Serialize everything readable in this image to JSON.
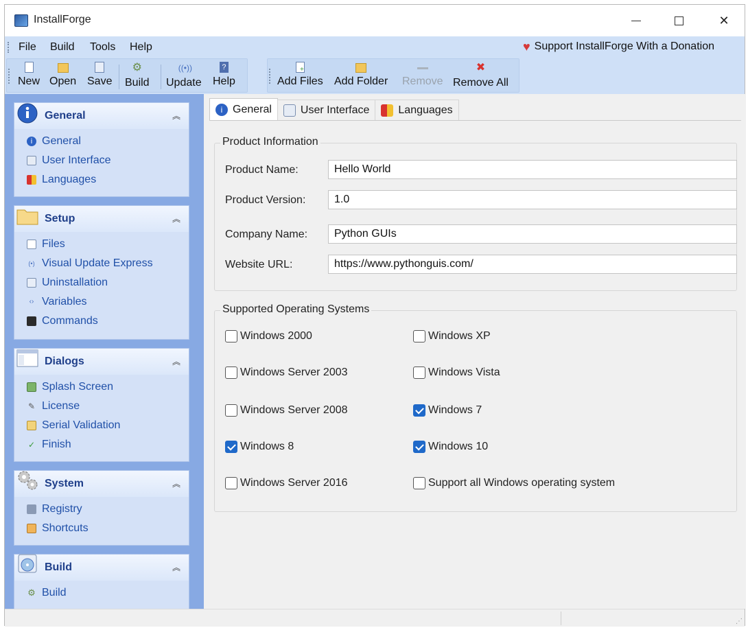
{
  "window": {
    "title": "InstallForge"
  },
  "menu": {
    "items": [
      "File",
      "Build",
      "Tools",
      "Help"
    ],
    "donate": "Support InstallForge With a Donation"
  },
  "toolbar1": {
    "new": "New",
    "open": "Open",
    "save": "Save",
    "build": "Build",
    "update": "Update",
    "help": "Help"
  },
  "toolbar2": {
    "add_files": "Add Files",
    "add_folder": "Add Folder",
    "remove": "Remove",
    "remove_all": "Remove All"
  },
  "sidebar": {
    "general": {
      "title": "General",
      "items": [
        "General",
        "User Interface",
        "Languages"
      ]
    },
    "setup": {
      "title": "Setup",
      "items": [
        "Files",
        "Visual Update Express",
        "Uninstallation",
        "Variables",
        "Commands"
      ]
    },
    "dialogs": {
      "title": "Dialogs",
      "items": [
        "Splash Screen",
        "License",
        "Serial Validation",
        "Finish"
      ]
    },
    "system": {
      "title": "System",
      "items": [
        "Registry",
        "Shortcuts"
      ]
    },
    "build": {
      "title": "Build",
      "items": [
        "Build"
      ]
    }
  },
  "tabs": [
    "General",
    "User Interface",
    "Languages"
  ],
  "product_info": {
    "title": "Product Information",
    "product_name_label": "Product Name:",
    "product_name": "Hello World",
    "product_version_label": "Product Version:",
    "product_version": "1.0",
    "company_name_label": "Company Name:",
    "company_name": "Python GUIs",
    "website_label": "Website URL:",
    "website": "https://www.pythonguis.com/"
  },
  "os": {
    "title": "Supported Operating Systems",
    "options": [
      {
        "label": "Windows 2000",
        "checked": false
      },
      {
        "label": "Windows XP",
        "checked": false
      },
      {
        "label": "Windows Server 2003",
        "checked": false
      },
      {
        "label": "Windows Vista",
        "checked": false
      },
      {
        "label": "Windows Server 2008",
        "checked": false
      },
      {
        "label": "Windows 7",
        "checked": true
      },
      {
        "label": "Windows 8",
        "checked": true
      },
      {
        "label": "Windows 10",
        "checked": true
      },
      {
        "label": "Windows Server 2016",
        "checked": false
      },
      {
        "label": "Support all Windows operating system",
        "checked": false
      }
    ]
  },
  "colors": {
    "accent": "#1f69c9",
    "sidebar_bg": "#87a9e3",
    "panel_bg": "#d4e1f7",
    "toolbar_bg": "#cfe0f7",
    "link": "#2050a8"
  }
}
